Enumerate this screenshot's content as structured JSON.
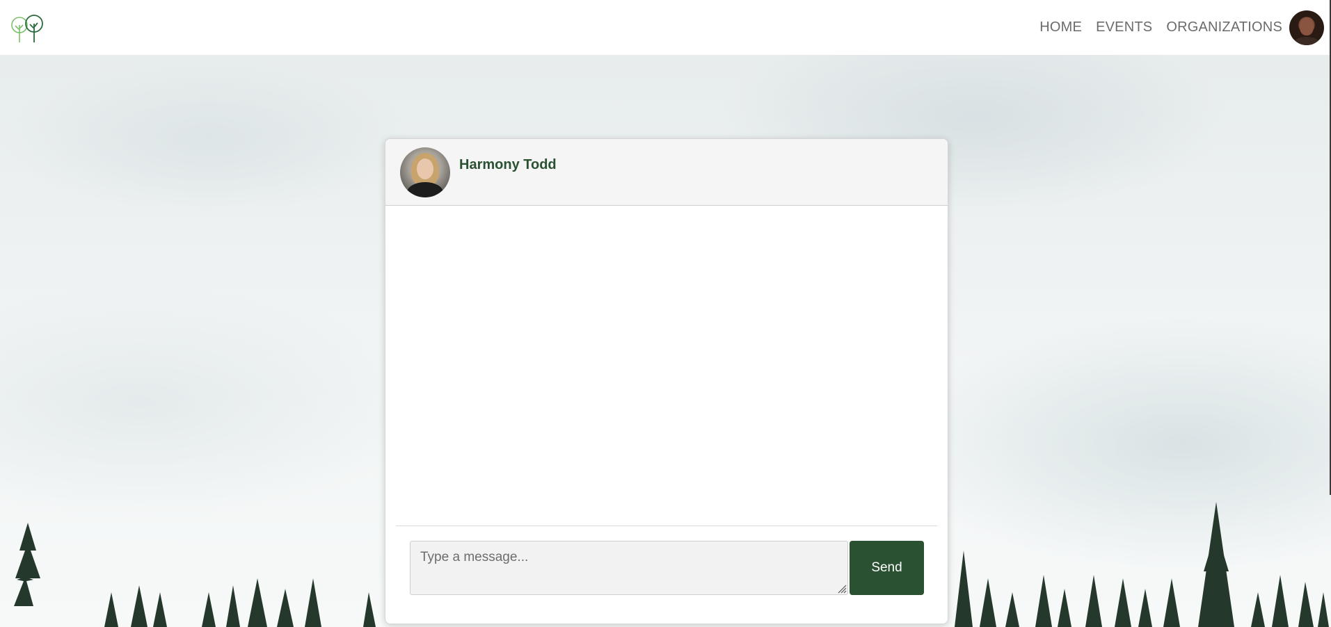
{
  "nav": {
    "logo": "trees-logo-icon",
    "links": [
      {
        "label": "HOME"
      },
      {
        "label": "EVENTS"
      },
      {
        "label": "ORGANIZATIONS"
      }
    ],
    "avatar": "user-avatar"
  },
  "chat": {
    "contact_name": "Harmony Todd",
    "input_placeholder": "Type a message...",
    "send_label": "Send"
  },
  "colors": {
    "brand_green": "#2a5132",
    "nav_text": "#6b6b6b",
    "header_bg": "#f5f5f5",
    "input_bg": "#f2f2f2"
  }
}
